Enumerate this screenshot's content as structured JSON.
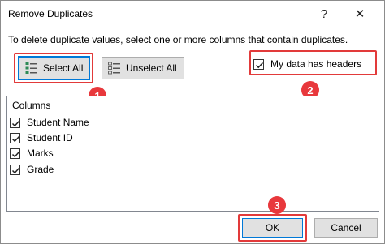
{
  "window": {
    "title": "Remove Duplicates",
    "help_label": "?",
    "close_label": "✕"
  },
  "instruction": "To delete duplicate values, select one or more columns that contain duplicates.",
  "buttons": {
    "select_all": "Select All",
    "unselect_all": "Unselect All",
    "ok": "OK",
    "cancel": "Cancel"
  },
  "headers_checkbox": {
    "label": "My data has headers",
    "checked": true
  },
  "columns": {
    "header": "Columns",
    "items": [
      {
        "label": "Student Name",
        "checked": true
      },
      {
        "label": "Student ID",
        "checked": true
      },
      {
        "label": "Marks",
        "checked": true
      },
      {
        "label": "Grade",
        "checked": true
      }
    ]
  },
  "annotations": {
    "badges": [
      "1",
      "2",
      "3"
    ],
    "highlight_color": "#e23a3a"
  },
  "colors": {
    "accent": "#0078d7",
    "button_face": "#e1e1e1"
  },
  "icons": {
    "select_all": "select-all-list-icon",
    "unselect_all": "unselect-all-list-icon",
    "check": "checkmark-icon"
  }
}
